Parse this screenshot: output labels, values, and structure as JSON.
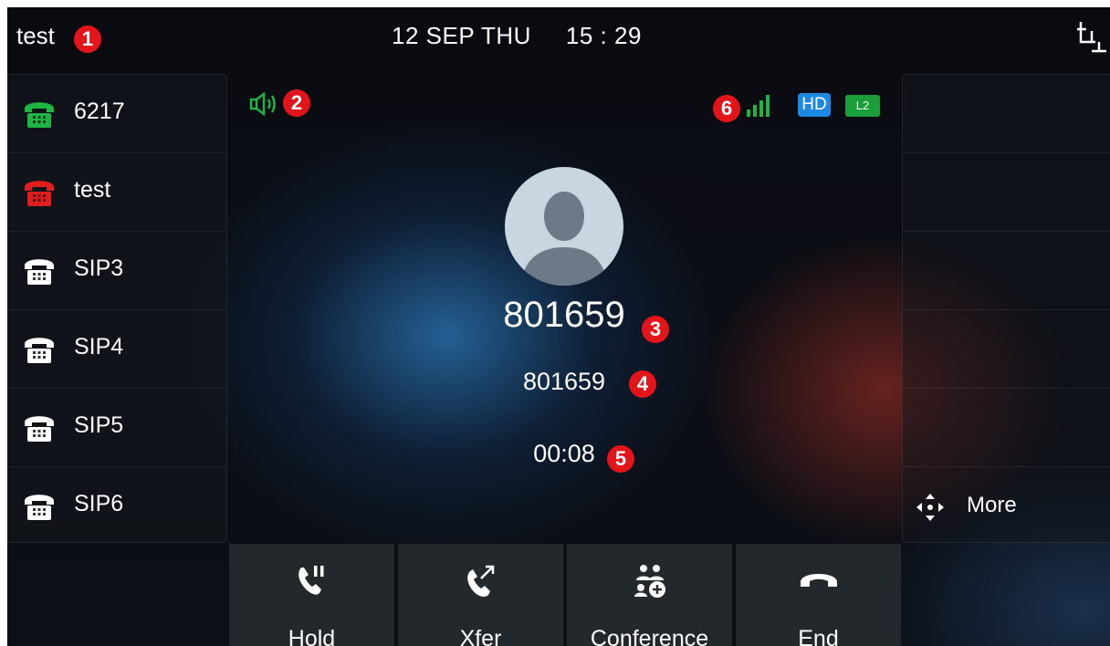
{
  "status_bar": {
    "account": "test",
    "date": "12 SEP THU",
    "time": "15 : 29"
  },
  "markers": [
    "1",
    "2",
    "3",
    "4",
    "5",
    "6"
  ],
  "line_keys": [
    {
      "label": "6217",
      "icon": "phone-icon",
      "color": "#1fb545"
    },
    {
      "label": "test",
      "icon": "phone-icon",
      "color": "#e01e1e"
    },
    {
      "label": "SIP3",
      "icon": "phone-icon",
      "color": "#ffffff"
    },
    {
      "label": "SIP4",
      "icon": "phone-icon",
      "color": "#ffffff"
    },
    {
      "label": "SIP5",
      "icon": "phone-icon",
      "color": "#ffffff"
    },
    {
      "label": "SIP6",
      "icon": "phone-icon",
      "color": "#ffffff"
    }
  ],
  "call": {
    "name": "801659",
    "number": "801659",
    "duration": "00:08",
    "audio_mode_icon": "speaker-icon",
    "hd_label": "HD",
    "line_badge": "L2"
  },
  "right_panel": {
    "more_label": "More"
  },
  "softkeys": [
    {
      "label": "Hold",
      "icon": "hold-icon"
    },
    {
      "label": "Xfer",
      "icon": "transfer-icon"
    },
    {
      "label": "Conference",
      "icon": "conference-icon"
    },
    {
      "label": "End",
      "icon": "end-call-icon"
    }
  ],
  "colors": {
    "green": "#1fb545",
    "red": "#e01e1e",
    "hd_blue": "#1e88e5",
    "marker_red": "#e4141b"
  }
}
